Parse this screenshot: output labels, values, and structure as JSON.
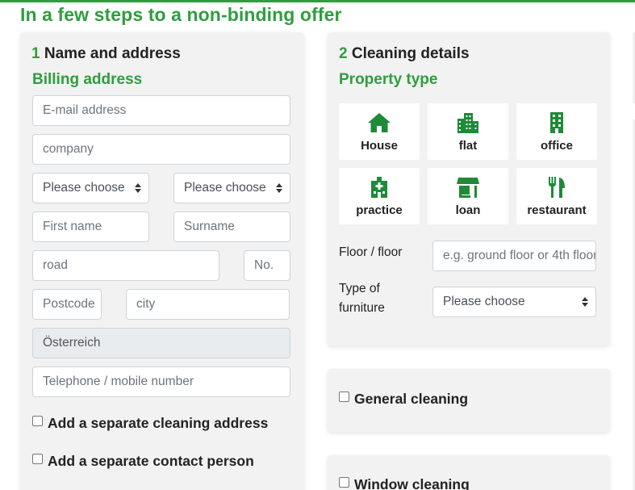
{
  "page": {
    "title": "In a few steps to a non-binding offer",
    "accent_color": "#2e9e3e"
  },
  "step1": {
    "number": "1",
    "title": "Name and address",
    "billing_heading": "Billing address",
    "email_placeholder": "E-mail address",
    "company_placeholder": "company",
    "salutation_select": "Please choose",
    "title_select": "Please choose",
    "first_name_placeholder": "First name",
    "surname_placeholder": "Surname",
    "road_placeholder": "road",
    "number_placeholder": "No.",
    "postcode_placeholder": "Postcode",
    "city_placeholder": "city",
    "country_value": "Österreich",
    "phone_placeholder": "Telephone / mobile number",
    "add_cleaning_address_label": "Add a separate cleaning address",
    "add_contact_person_label": "Add a separate contact person"
  },
  "step2": {
    "number": "2",
    "title": "Cleaning details",
    "property_heading": "Property type",
    "property_types": [
      {
        "label": "House",
        "icon": "house-icon"
      },
      {
        "label": "flat",
        "icon": "apartment-building-icon"
      },
      {
        "label": "office",
        "icon": "office-building-icon"
      },
      {
        "label": "practice",
        "icon": "hospital-icon"
      },
      {
        "label": "loan",
        "icon": "store-icon"
      },
      {
        "label": "restaurant",
        "icon": "utensils-icon"
      }
    ],
    "floor_label": "Floor / floor",
    "floor_placeholder": "e.g. ground floor or 4th floor",
    "furniture_label_line1": "Type of",
    "furniture_label_line2": "furniture",
    "furniture_select": "Please choose"
  },
  "services": {
    "general_cleaning_label": "General cleaning",
    "window_cleaning_label": "Window cleaning"
  }
}
